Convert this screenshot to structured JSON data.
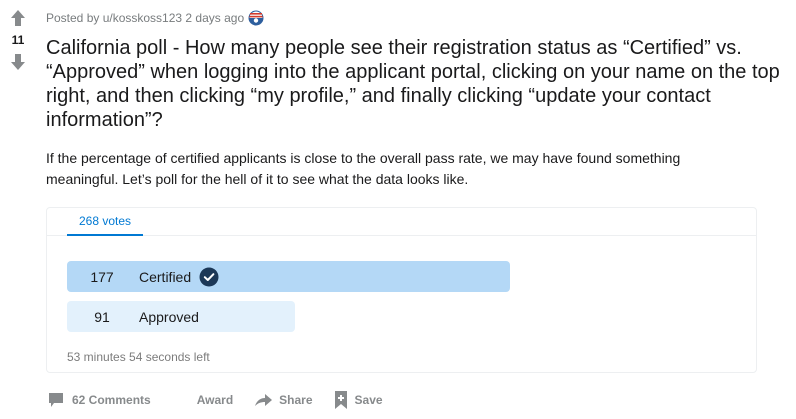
{
  "post": {
    "vote_count": "11",
    "byline": "Posted by u/kosskoss123 2 days ago",
    "title": "California poll - How many people see their registration status as “Certified” vs. “Approved” when logging into the applicant portal, clicking on your name on the top right, and then clicking “my profile,” and finally clicking “update your contact information”?",
    "body": "If the percentage of certified applicants is close to the overall pass rate, we may have found something meaningful. Let’s poll for the hell of it to see what the data looks like."
  },
  "poll": {
    "votes_tab": "268 votes",
    "options": [
      {
        "count": "177",
        "label": "Certified",
        "share": 0.66,
        "selected": true
      },
      {
        "count": "91",
        "label": "Approved",
        "share": 0.34,
        "selected": false
      }
    ],
    "time_left": "53 minutes 54 seconds left"
  },
  "actions": {
    "comments": "62 Comments",
    "award": "Award",
    "share": "Share",
    "save": "Save"
  },
  "icons": {
    "upvote": "upvote-arrow-icon",
    "downvote": "downvote-arrow-icon",
    "badge": "flair-badge-icon",
    "check": "checkmark-circle-icon",
    "comment": "comment-bubble-icon",
    "share": "share-arrow-icon",
    "save": "bookmark-plus-icon"
  },
  "colors": {
    "accent": "#0079d3",
    "selected_bar": "#b4d8f6",
    "unselected_bar": "#e3f1fc",
    "muted": "#878a8c"
  }
}
